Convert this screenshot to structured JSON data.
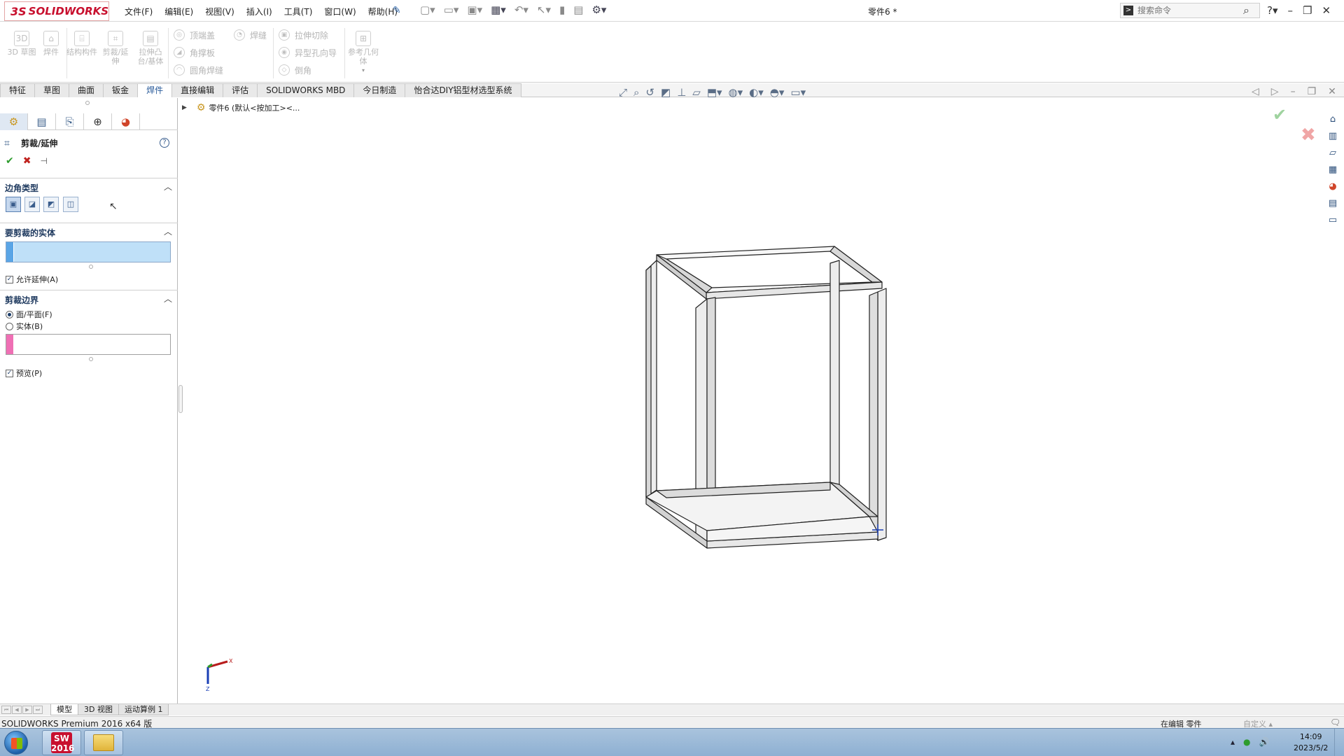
{
  "app": {
    "logo_ds": "3S",
    "logo_text": "SOLIDWORKS",
    "document_title": "零件6 *"
  },
  "menu": [
    "文件(F)",
    "编辑(E)",
    "视图(V)",
    "插入(I)",
    "工具(T)",
    "窗口(W)",
    "帮助(H)"
  ],
  "search": {
    "placeholder": "搜索命令"
  },
  "command_manager": {
    "big_buttons": [
      "3D 草图",
      "焊件",
      "结构构件",
      "剪裁/延伸",
      "拉伸凸台/基体"
    ],
    "col1": [
      "顶端盖",
      "角撑板",
      "圆角焊缝"
    ],
    "col1b": [
      "焊缝"
    ],
    "col2": [
      "拉伸切除",
      "异型孔向导",
      "倒角"
    ],
    "ref_geometry": "参考几何体"
  },
  "tabs": [
    {
      "label": "特征",
      "active": false
    },
    {
      "label": "草图",
      "active": false
    },
    {
      "label": "曲面",
      "active": false
    },
    {
      "label": "钣金",
      "active": false
    },
    {
      "label": "焊件",
      "active": true
    },
    {
      "label": "直接编辑",
      "active": false
    },
    {
      "label": "评估",
      "active": false
    },
    {
      "label": "SOLIDWORKS MBD",
      "active": false
    },
    {
      "label": "今日制造",
      "active": false
    },
    {
      "label": "怡合达DIY铝型材选型系统",
      "active": false
    }
  ],
  "feature_tree": {
    "part_label": "零件6 (默认<按加工><..."
  },
  "property_manager": {
    "title": "剪裁/延伸",
    "help": "?",
    "corner_type": {
      "title": "边角类型",
      "buttons": [
        "corner-type-end-trim",
        "corner-type-end-miter",
        "corner-type-end-butt1",
        "corner-type-end-butt2"
      ],
      "selected_index": 0
    },
    "bodies_to_trim": {
      "title": "要剪裁的实体",
      "color": "#8fc5ef",
      "allow_extension_label": "允许延伸(A)",
      "allow_extension_checked": true
    },
    "trim_boundary": {
      "title": "剪裁边界",
      "option_face": "面/平面(F)",
      "option_body": "实体(B)",
      "selected": "face",
      "color": "#ef6fb4",
      "preview_label": "预览(P)",
      "preview_checked": true
    }
  },
  "bottom_tabs": [
    {
      "label": "模型",
      "active": true
    },
    {
      "label": "3D 视图",
      "active": false
    },
    {
      "label": "运动算例 1",
      "active": false
    }
  ],
  "status": {
    "product": "SOLIDWORKS Premium 2016 x64 版",
    "mode": "在编辑 零件",
    "custom": "自定义"
  },
  "taskbar": {
    "sw_label": "SW 2016",
    "time": "14:09",
    "date": "2023/5/2"
  },
  "colors": {
    "brand_red": "#c8102e",
    "accept_green": "#2e9c2e",
    "cancel_red": "#c0221e",
    "active_tab_text": "#2a5b9a"
  }
}
